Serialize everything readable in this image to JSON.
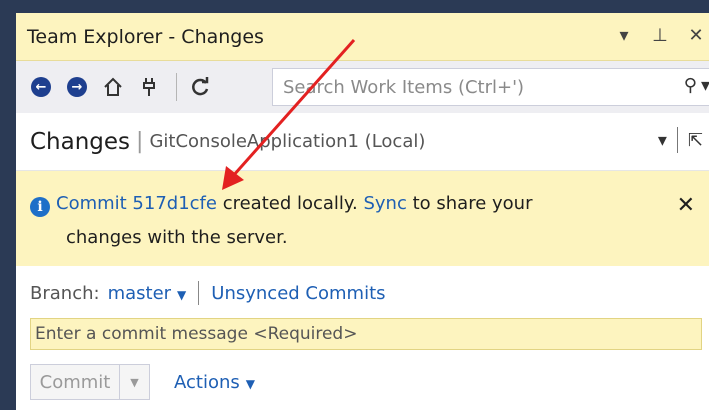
{
  "window": {
    "title": "Team Explorer - Changes",
    "controls": {
      "dropdown": "▾",
      "pin": "ᵖ",
      "close": "✕"
    }
  },
  "toolbar": {
    "search_placeholder": "Search Work Items (Ctrl+')",
    "icons": [
      "back-icon",
      "forward-icon",
      "home-icon",
      "connect-icon",
      "refresh-icon"
    ]
  },
  "header": {
    "title": "Changes",
    "separator": "|",
    "repo": "GitConsoleApplication1 (Local)"
  },
  "notification": {
    "link_commit": "Commit 517d1cfe",
    "text1": " created locally. ",
    "link_sync": "Sync",
    "text2": " to share your",
    "line2": "changes with the server.",
    "close": "✕"
  },
  "branch": {
    "label": "Branch:",
    "name": "master",
    "unsynced": "Unsynced Commits"
  },
  "commit": {
    "placeholder": "Enter a commit message <Required>",
    "button": "Commit",
    "actions": "Actions"
  },
  "colors": {
    "accent": "#1e5fb4",
    "info_bg": "#fdf4bf",
    "arrow": "#e32121"
  }
}
